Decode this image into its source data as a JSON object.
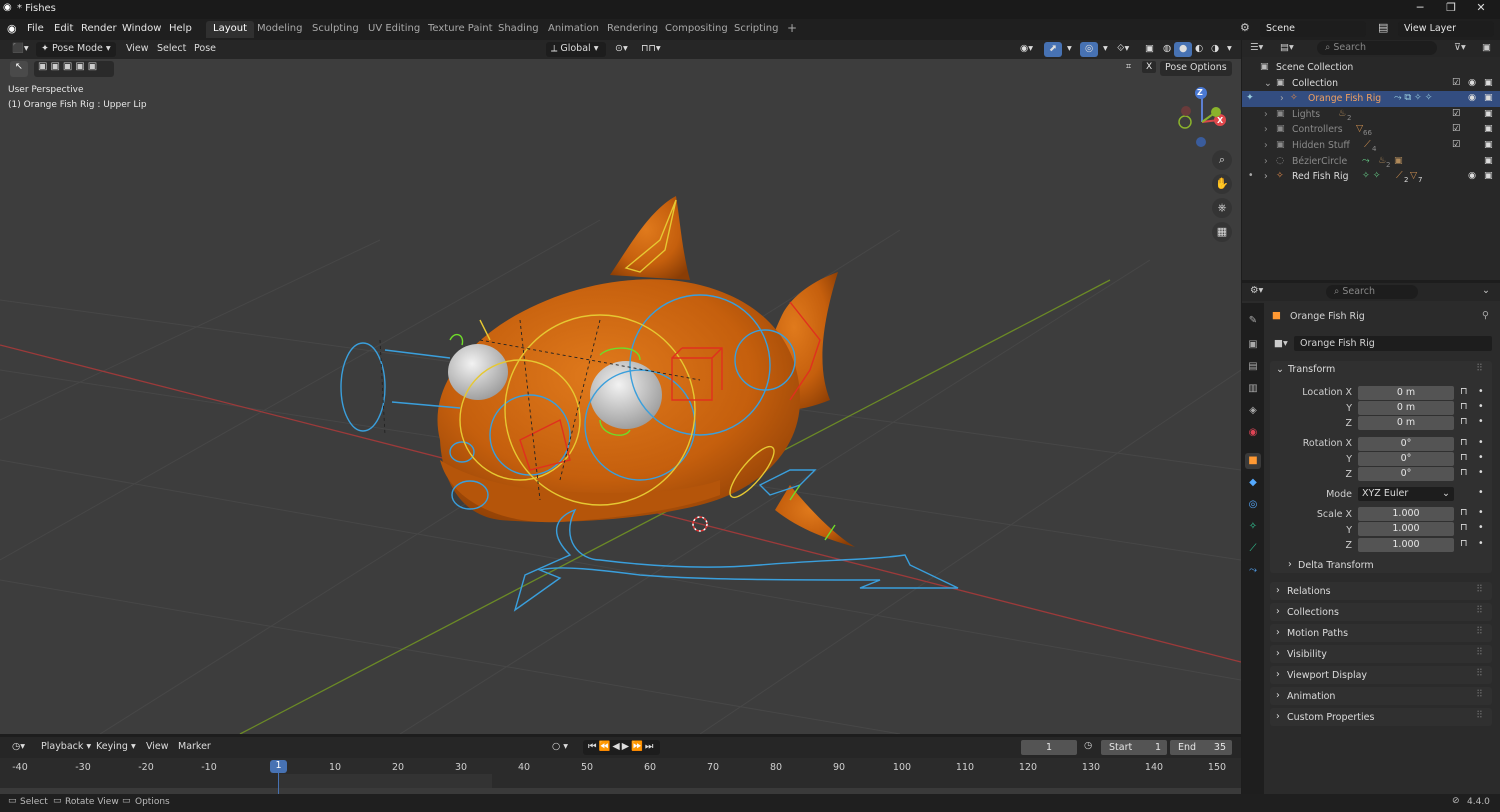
{
  "window": {
    "title": "* Fishes",
    "minimize": "─",
    "maximize": "❐",
    "close": "✕"
  },
  "menu": {
    "items": [
      "File",
      "Edit",
      "Render",
      "Window",
      "Help"
    ]
  },
  "workspaces": {
    "tabs": [
      "Layout",
      "Modeling",
      "Sculpting",
      "UV Editing",
      "Texture Paint",
      "Shading",
      "Animation",
      "Rendering",
      "Compositing",
      "Scripting"
    ],
    "active": "Layout",
    "add": "+"
  },
  "scene": {
    "name": "Scene",
    "view_layer": "View Layer"
  },
  "viewport": {
    "mode": "Pose Mode",
    "menus": [
      "View",
      "Select",
      "Pose"
    ],
    "transform_orientation": "Global",
    "pose_options": "Pose Options",
    "perspective": "User Perspective",
    "active": "(1) Orange Fish Rig : Upper Lip",
    "gizmo": {
      "z": "Z",
      "x": "X",
      "y": "Y"
    }
  },
  "outliner": {
    "search_placeholder": "Search",
    "scene_collection": "Scene Collection",
    "rows": [
      {
        "label": "Collection"
      },
      {
        "label": "Orange Fish Rig"
      },
      {
        "label": "Lights",
        "badge": "2"
      },
      {
        "label": "Controllers",
        "badge": "66"
      },
      {
        "label": "Hidden Stuff",
        "badge": "4"
      },
      {
        "label": "BézierCircle",
        "badge": "2"
      },
      {
        "label": "Red Fish Rig",
        "badge": "2",
        "badge2": "7"
      }
    ]
  },
  "properties": {
    "search_placeholder": "Search",
    "object_name": "Orange Fish Rig",
    "datablock": "Orange Fish Rig",
    "transform_title": "Transform",
    "location_label": "Location X",
    "rotation_label": "Rotation X",
    "scale_label": "Scale X",
    "y_label": "Y",
    "z_label": "Z",
    "location": [
      "0 m",
      "0 m",
      "0 m"
    ],
    "rotation": [
      "0°",
      "0°",
      "0°"
    ],
    "mode_label": "Mode",
    "mode_value": "XYZ Euler",
    "scale": [
      "1.000",
      "1.000",
      "1.000"
    ],
    "delta": "Delta Transform",
    "panels": [
      "Relations",
      "Collections",
      "Motion Paths",
      "Visibility",
      "Viewport Display",
      "Animation",
      "Custom Properties"
    ]
  },
  "timeline": {
    "menus": [
      "Playback",
      "Keying",
      "View",
      "Marker"
    ],
    "current_frame": "1",
    "start_label": "Start",
    "start": "1",
    "end_label": "End",
    "end": "35",
    "ticks": [
      "-40",
      "-30",
      "-20",
      "-10",
      "10",
      "20",
      "30",
      "40",
      "50",
      "60",
      "70",
      "80",
      "90",
      "100",
      "110",
      "120",
      "130",
      "140",
      "150"
    ],
    "playhead": "1"
  },
  "status": {
    "select": "Select",
    "rotate": "Rotate View",
    "options": "Options",
    "version": "4.4.0"
  },
  "colors": {
    "accent": "#4772b3",
    "rig_blue": "#3a9fdc",
    "rig_yellow": "#e6c832",
    "rig_red": "#e0301e",
    "rig_green": "#6fdc2a",
    "fish": "#c8620e",
    "axis_red": "#b33a3a",
    "axis_green": "#6a8a28"
  }
}
